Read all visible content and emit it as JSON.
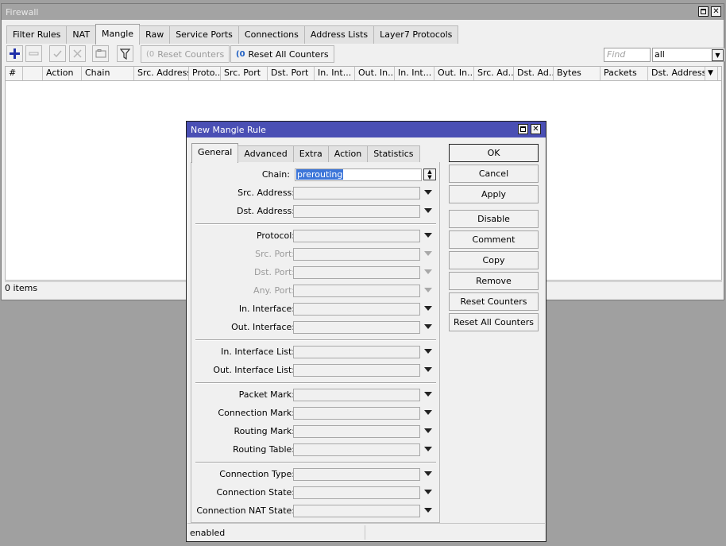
{
  "firewall": {
    "title": "Firewall",
    "tabs": [
      "Filter Rules",
      "NAT",
      "Mangle",
      "Raw",
      "Service Ports",
      "Connections",
      "Address Lists",
      "Layer7 Protocols"
    ],
    "toolbar": {
      "reset_counters": "Reset Counters",
      "reset_all_counters": "Reset All Counters",
      "find_placeholder": "Find",
      "filter_value": "all"
    },
    "columns": [
      "#",
      "",
      "Action",
      "Chain",
      "Src. Address",
      "Proto...",
      "Src. Port",
      "Dst. Port",
      "In. Int...",
      "Out. In...",
      "In. Int...",
      "Out. In...",
      "Src. Ad...",
      "Dst. Ad...",
      "Bytes",
      "Packets",
      "Dst. Address"
    ],
    "status": "0 items"
  },
  "dialog": {
    "title": "New Mangle Rule",
    "tabs": [
      "General",
      "Advanced",
      "Extra",
      "Action",
      "Statistics"
    ],
    "fields": {
      "chain": {
        "label": "Chain:",
        "value": "prerouting"
      },
      "src_address": {
        "label": "Src. Address:"
      },
      "dst_address": {
        "label": "Dst. Address:"
      },
      "protocol": {
        "label": "Protocol:"
      },
      "src_port": {
        "label": "Src. Port:"
      },
      "dst_port": {
        "label": "Dst. Port:"
      },
      "any_port": {
        "label": "Any. Port:"
      },
      "in_interface": {
        "label": "In. Interface:"
      },
      "out_interface": {
        "label": "Out. Interface:"
      },
      "in_interface_list": {
        "label": "In. Interface List:"
      },
      "out_interface_list": {
        "label": "Out. Interface List:"
      },
      "packet_mark": {
        "label": "Packet Mark:"
      },
      "connection_mark": {
        "label": "Connection Mark:"
      },
      "routing_mark": {
        "label": "Routing Mark:"
      },
      "routing_table": {
        "label": "Routing Table:"
      },
      "connection_type": {
        "label": "Connection Type:"
      },
      "connection_state": {
        "label": "Connection State:"
      },
      "connection_nat_state": {
        "label": "Connection NAT State:"
      }
    },
    "buttons": [
      "OK",
      "Cancel",
      "Apply",
      "Disable",
      "Comment",
      "Copy",
      "Remove",
      "Reset Counters",
      "Reset All Counters"
    ],
    "status": "enabled"
  }
}
